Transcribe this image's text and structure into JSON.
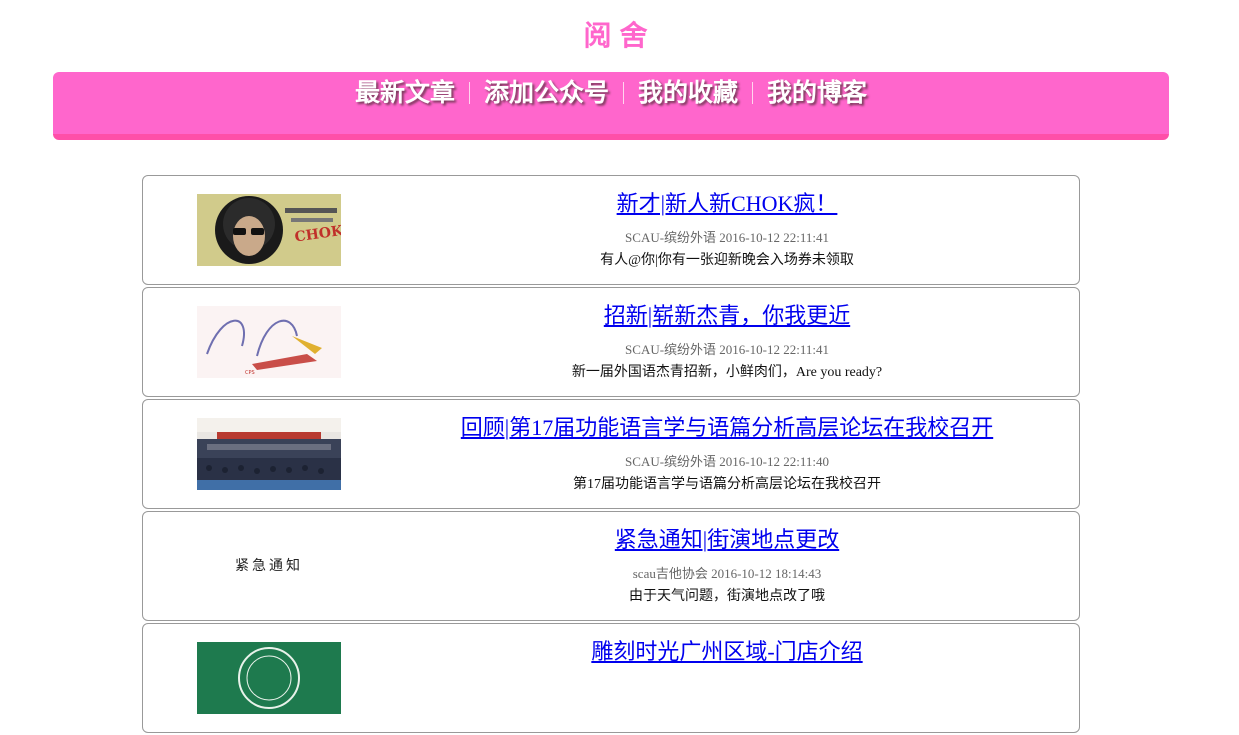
{
  "site": {
    "title": "阅舍"
  },
  "nav": {
    "items": [
      {
        "label": "最新文章"
      },
      {
        "label": "添加公众号"
      },
      {
        "label": "我的收藏"
      },
      {
        "label": "我的博客"
      }
    ]
  },
  "colors": {
    "accent": "#ff66cc",
    "link": "#0000ee",
    "meta": "#666666"
  },
  "articles": [
    {
      "title": "新才|新人新CHOK疯！",
      "meta": "SCAU-缤纷外语 2016-10-12 22:11:41",
      "desc": "有人@你|你有一张迎新晚会入场券未领取",
      "thumb_icon": "chok-poster-image"
    },
    {
      "title": "招新|崭新杰青，你我更近",
      "meta": "SCAU-缤纷外语 2016-10-12 22:11:41",
      "desc": "新一届外国语杰青招新，小鲜肉们，Are you ready?",
      "thumb_icon": "cps-logo-image"
    },
    {
      "title": "回顾|第17届功能语言学与语篇分析高层论坛在我校召开",
      "meta": "SCAU-缤纷外语 2016-10-12 22:11:40",
      "desc": "第17届功能语言学与语篇分析高层论坛在我校召开",
      "thumb_icon": "conference-photo-image"
    },
    {
      "title": "紧急通知|街演地点更改",
      "meta": "scau吉他协会 2016-10-12 18:14:43",
      "desc": "由于天气问题，街演地点改了哦",
      "thumb_icon": "urgent-notice-image",
      "thumb_text": "紧急通知"
    },
    {
      "title": "雕刻时光广州区域-门店介绍",
      "meta": "",
      "desc": "",
      "thumb_icon": "cafe-logo-image"
    }
  ]
}
